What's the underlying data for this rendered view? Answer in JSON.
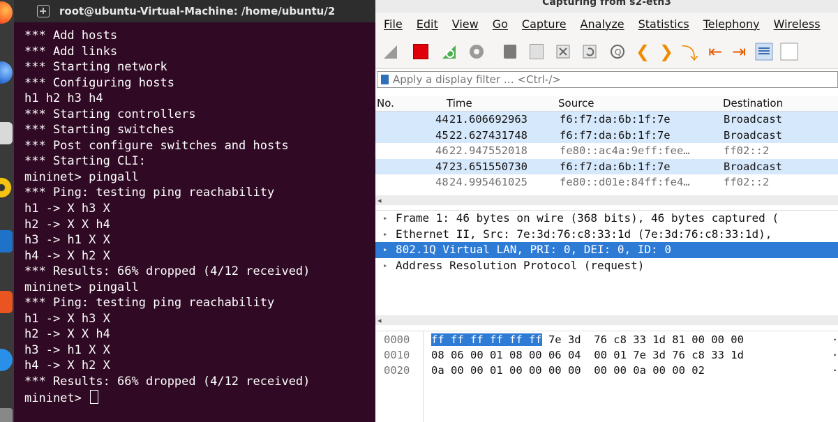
{
  "terminal": {
    "title": "root@ubuntu-Virtual-Machine: /home/ubuntu/2",
    "lines": [
      "*** Add hosts",
      "*** Add links",
      "*** Starting network",
      "*** Configuring hosts",
      "h1 h2 h3 h4",
      "*** Starting controllers",
      "*** Starting switches",
      "*** Post configure switches and hosts",
      "*** Starting CLI:",
      "mininet> pingall",
      "*** Ping: testing ping reachability",
      "h1 -> X h3 X",
      "h2 -> X X h4",
      "h3 -> h1 X X",
      "h4 -> X h2 X",
      "*** Results: 66% dropped (4/12 received)",
      "mininet> pingall",
      "*** Ping: testing ping reachability",
      "h1 -> X h3 X",
      "h2 -> X X h4",
      "h3 -> h1 X X",
      "h4 -> X h2 X",
      "*** Results: 66% dropped (4/12 received)",
      "mininet> "
    ]
  },
  "wireshark": {
    "title": "Capturing from s2-eth3",
    "menu": [
      "File",
      "Edit",
      "View",
      "Go",
      "Capture",
      "Analyze",
      "Statistics",
      "Telephony",
      "Wireless"
    ],
    "toolbar_icons": [
      "shark-fin-start-icon",
      "stop-capture-icon",
      "restart-capture-icon",
      "capture-options-icon",
      "open-file-icon",
      "save-file-icon",
      "close-file-icon",
      "reload-file-icon",
      "find-packet-icon",
      "go-back-icon",
      "go-forward-icon",
      "go-to-packet-icon",
      "go-first-icon",
      "go-last-icon",
      "autoscroll-icon",
      "colorize-icon"
    ],
    "filter_placeholder": "Apply a display filter … <Ctrl-/>",
    "packet_list": {
      "columns": [
        "No.",
        "Time",
        "Source",
        "Destination"
      ],
      "rows": [
        {
          "no": "44",
          "time": "21.606692963",
          "source": "f6:f7:da:6b:1f:7e",
          "destination": "Broadcast",
          "kind": "arp"
        },
        {
          "no": "45",
          "time": "22.627431748",
          "source": "f6:f7:da:6b:1f:7e",
          "destination": "Broadcast",
          "kind": "arp"
        },
        {
          "no": "46",
          "time": "22.947552018",
          "source": "fe80::ac4a:9eff:fee…",
          "destination": "ff02::2",
          "kind": "mdns"
        },
        {
          "no": "47",
          "time": "23.651550730",
          "source": "f6:f7:da:6b:1f:7e",
          "destination": "Broadcast",
          "kind": "arp"
        },
        {
          "no": "48",
          "time": "24.995461025",
          "source": "fe80::d01e:84ff:fe4…",
          "destination": "ff02::2",
          "kind": "mdns"
        }
      ],
      "colors": {
        "arp": "#d6e8fb",
        "mdns": "#ffffff"
      }
    },
    "details": [
      {
        "text": "Frame 1: 46 bytes on wire (368 bits), 46 bytes captured (",
        "selected": false
      },
      {
        "text": "Ethernet II, Src: 7e:3d:76:c8:33:1d (7e:3d:76:c8:33:1d),",
        "selected": false
      },
      {
        "text": "802.1Q Virtual LAN, PRI: 0, DEI: 0, ID: 0",
        "selected": true
      },
      {
        "text": "Address Resolution Protocol (request)",
        "selected": false
      }
    ],
    "bytes": [
      {
        "offset": "0000",
        "hex_highlight": "ff ff ff ff ff ff",
        "hex_rest": " 7e 3d  76 c8 33 1d 81 00 00 00",
        "ascii": "·"
      },
      {
        "offset": "0010",
        "hex_highlight": "",
        "hex_rest": "08 06 00 01 08 00 06 04  00 01 7e 3d 76 c8 33 1d",
        "ascii": "·"
      },
      {
        "offset": "0020",
        "hex_highlight": "",
        "hex_rest": "0a 00 00 01 00 00 00 00  00 00 0a 00 00 02",
        "ascii": "·"
      }
    ],
    "accent": "#2e7bd6"
  }
}
